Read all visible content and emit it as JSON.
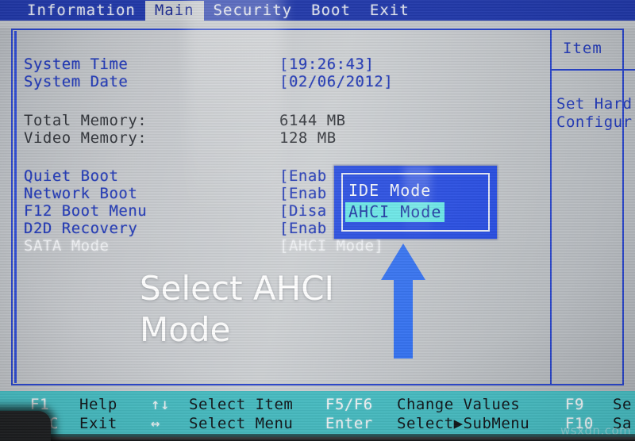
{
  "menubar": {
    "tabs": [
      {
        "label": "Information",
        "active": false
      },
      {
        "label": "Main",
        "active": true
      },
      {
        "label": "Security",
        "active": false
      },
      {
        "label": "Boot",
        "active": false
      },
      {
        "label": "Exit",
        "active": false
      }
    ]
  },
  "settings": {
    "rows": [
      {
        "label": "System Time",
        "value": "[19:26:43]",
        "style": "blue"
      },
      {
        "label": "System Date",
        "value": "[02/06/2012]",
        "style": "blue"
      },
      {
        "label": "Total Memory:",
        "value": "6144 MB",
        "style": "dark"
      },
      {
        "label": "Video Memory:",
        "value": "128 MB",
        "style": "dark"
      },
      {
        "label": "Quiet Boot",
        "value": "[Enab",
        "style": "blue"
      },
      {
        "label": "Network Boot",
        "value": "[Enab",
        "style": "blue"
      },
      {
        "label": "F12 Boot Menu",
        "value": "[Disa",
        "style": "blue"
      },
      {
        "label": "D2D Recovery",
        "value": "[Enab",
        "style": "blue"
      },
      {
        "label": "SATA Mode",
        "value": "[AHCI Mode]",
        "style": "white"
      }
    ]
  },
  "help": {
    "title": "Item",
    "line1": "Set Hard",
    "line2": "Configur"
  },
  "popup": {
    "options": [
      {
        "label": "IDE Mode",
        "selected": false
      },
      {
        "label": "AHCI Mode",
        "selected": true
      }
    ]
  },
  "annotation": {
    "line1": "Select AHCI",
    "line2": "Mode",
    "arrow_direction": "up",
    "arrow_color": "#2f6ef0",
    "text_color": "#ffffff"
  },
  "keybar": {
    "rows": [
      {
        "items": [
          {
            "key": "F1",
            "desc": "Help"
          },
          {
            "key": "↑↓",
            "desc": "Select Item"
          },
          {
            "key": "F5/F6",
            "desc": "Change Values"
          },
          {
            "key": "F9",
            "desc": "Se"
          }
        ]
      },
      {
        "items": [
          {
            "key": "ESC",
            "desc": "Exit"
          },
          {
            "key": "↔",
            "desc": "Select Menu"
          },
          {
            "key": "Enter",
            "desc": "Select▶SubMenu"
          },
          {
            "key": "F10",
            "desc": "Sa"
          }
        ]
      }
    ]
  },
  "watermark": {
    "text": "wsxdn.com"
  },
  "colors": {
    "menubar_bg": "#1d35a8",
    "screen_bg": "#c3c6ca",
    "frame_border": "#2440c8",
    "text_blue": "#1c34b4",
    "keybar_bg": "#45bdc3",
    "popup_bg": "#1f46e0",
    "popup_highlight": "#63e6e6"
  }
}
